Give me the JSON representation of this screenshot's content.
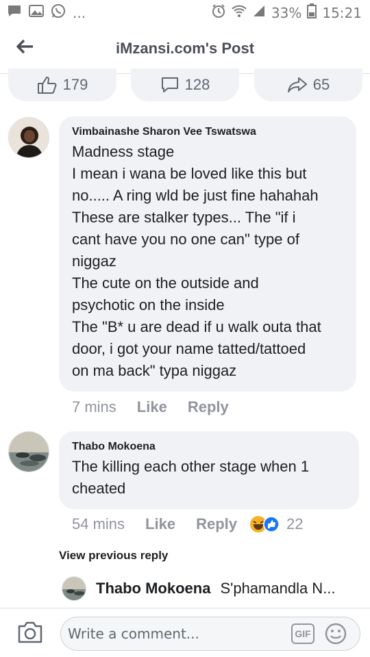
{
  "status_bar": {
    "left_icons": [
      "chat-icon",
      "image-icon",
      "whatsapp-icon"
    ],
    "more": "...",
    "battery": "33%",
    "time": "15:21"
  },
  "header": {
    "title": "iMzansi.com's Post"
  },
  "reactions": {
    "likes": "179",
    "comments": "128",
    "shares": "65"
  },
  "comments": [
    {
      "author": "Vimbainashe Sharon Vee Tswatswa",
      "lines": [
        "Madness stage",
        "I mean i wana be loved like this but",
        "no..... A ring wld be just fine hahahah",
        "These are stalker types... The \"if i",
        "cant have you no one can\" type of",
        "niggaz",
        "The cute on the outside and",
        "psychotic on the inside",
        "The \"B* u are dead if u walk outa that",
        "door, i got your name tatted/tattoed",
        "on ma back\" typa niggaz"
      ],
      "time": "7 mins",
      "like": "Like",
      "reply": "Reply"
    },
    {
      "author": "Thabo Mokoena",
      "lines": [
        "The killing  each other  stage  when  1",
        "cheated"
      ],
      "time": "54 mins",
      "like": "Like",
      "reply": "Reply",
      "reaction_count": "22"
    }
  ],
  "view_previous": "View previous reply",
  "reply_preview": {
    "author": "Thabo Mokoena",
    "text": "S'phamandla N..."
  },
  "composer": {
    "placeholder": "Write a comment...",
    "gif": "GIF"
  },
  "colors": {
    "bubble": "#f0f2f5",
    "muted": "#90949c",
    "text": "#1c1e21",
    "accent": "#1877f2"
  }
}
